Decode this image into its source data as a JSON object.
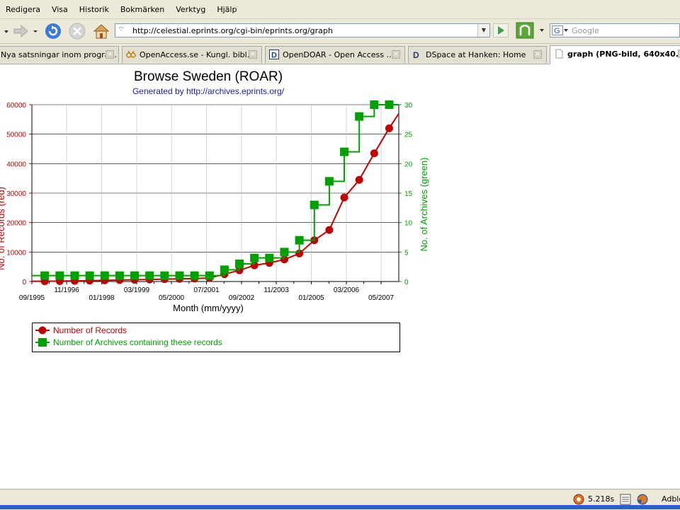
{
  "menu": {
    "items": [
      "Redigera",
      "Visa",
      "Historik",
      "Bokmärken",
      "Verktyg",
      "Hjälp"
    ]
  },
  "navigation": {
    "url": "http://celestial.eprints.org/cgi-bin/eprints.org/graph",
    "search_placeholder": "Google"
  },
  "tabs": [
    {
      "label": "Nya satsningar inom progra...",
      "icon": "page-icon",
      "active": false
    },
    {
      "label": "OpenAccess.se - Kungl. bibl...",
      "icon": "openaccess-icon",
      "active": false
    },
    {
      "label": "OpenDOAR - Open Access ...",
      "icon": "opendoar-icon",
      "active": false
    },
    {
      "label": "DSpace at Hanken: Home",
      "icon": "dspace-icon",
      "active": false
    },
    {
      "label": "graph (PNG-bild, 640x40...",
      "icon": "page-icon",
      "active": true
    }
  ],
  "status": {
    "timing": "5.218s",
    "adblock": "Adblo"
  },
  "chart": {
    "title": "Browse Sweden (ROAR)",
    "subtitle": "Generated by http://archives.eprints.org/",
    "xlabel": "Month (mm/yyyy)",
    "ylabel_left": "No. of Records (red)",
    "ylabel_right": "No. of Archives (green)",
    "legend": [
      "Number of Records",
      "Number of Archives containing these records"
    ]
  },
  "chart_data": {
    "type": "line",
    "title": "Browse Sweden (ROAR)",
    "subtitle": "Generated by http://archives.eprints.org/",
    "xlabel": "Month (mm/yyyy)",
    "x_ticks_bottom": [
      "09/1995",
      "01/1998",
      "05/2000",
      "09/2002",
      "01/2005",
      "05/2007"
    ],
    "x_ticks_top": [
      "11/1996",
      "03/1999",
      "07/2001",
      "11/2003",
      "03/2006"
    ],
    "x_tick_values": [
      1995.67,
      1996.83,
      1998.0,
      1999.17,
      2000.33,
      2001.5,
      2002.67,
      2003.83,
      2005.0,
      2006.17,
      2007.33
    ],
    "xlim": [
      1995.67,
      2007.92
    ],
    "y_left": {
      "label": "No. of Records (red)",
      "lim": [
        0,
        60000
      ],
      "ticks": [
        0,
        10000,
        20000,
        30000,
        40000,
        50000,
        60000
      ],
      "color": "#c00000"
    },
    "y_right": {
      "label": "No. of Archives (green)",
      "lim": [
        0,
        30
      ],
      "ticks": [
        0,
        5,
        10,
        15,
        20,
        25,
        30
      ],
      "color": "#00a000"
    },
    "grid": true,
    "legend_position": "below",
    "series": [
      {
        "name": "Number of Records",
        "axis": "left",
        "color": "#c00000",
        "marker": "circle",
        "x": [
          1996.1,
          1996.6,
          1997.1,
          1997.6,
          1998.1,
          1998.6,
          1999.1,
          1999.6,
          2000.1,
          2000.6,
          2001.1,
          2001.6,
          2002.1,
          2002.6,
          2003.1,
          2003.6,
          2004.1,
          2004.6,
          2005.1,
          2005.6,
          2006.1,
          2006.6,
          2007.1,
          2007.6
        ],
        "y": [
          100,
          150,
          200,
          300,
          400,
          500,
          600,
          700,
          800,
          900,
          1000,
          1200,
          2500,
          3800,
          5500,
          6300,
          7500,
          9500,
          14000,
          17500,
          28500,
          34500,
          43500,
          52000
        ]
      },
      {
        "name": "Number of Archives containing these records",
        "axis": "right",
        "color": "#00a000",
        "marker": "square",
        "x": [
          1996.1,
          1996.6,
          1997.1,
          1997.6,
          1998.1,
          1998.6,
          1999.1,
          1999.6,
          2000.1,
          2000.6,
          2001.1,
          2001.6,
          2002.1,
          2002.6,
          2003.1,
          2003.6,
          2004.1,
          2004.6,
          2005.1,
          2005.6,
          2006.1,
          2006.6,
          2007.1,
          2007.6
        ],
        "y": [
          1,
          1,
          1,
          1,
          1,
          1,
          1,
          1,
          1,
          1,
          1,
          1,
          2,
          3,
          4,
          4,
          5,
          7,
          13,
          17,
          22,
          28,
          30,
          30
        ]
      }
    ]
  }
}
